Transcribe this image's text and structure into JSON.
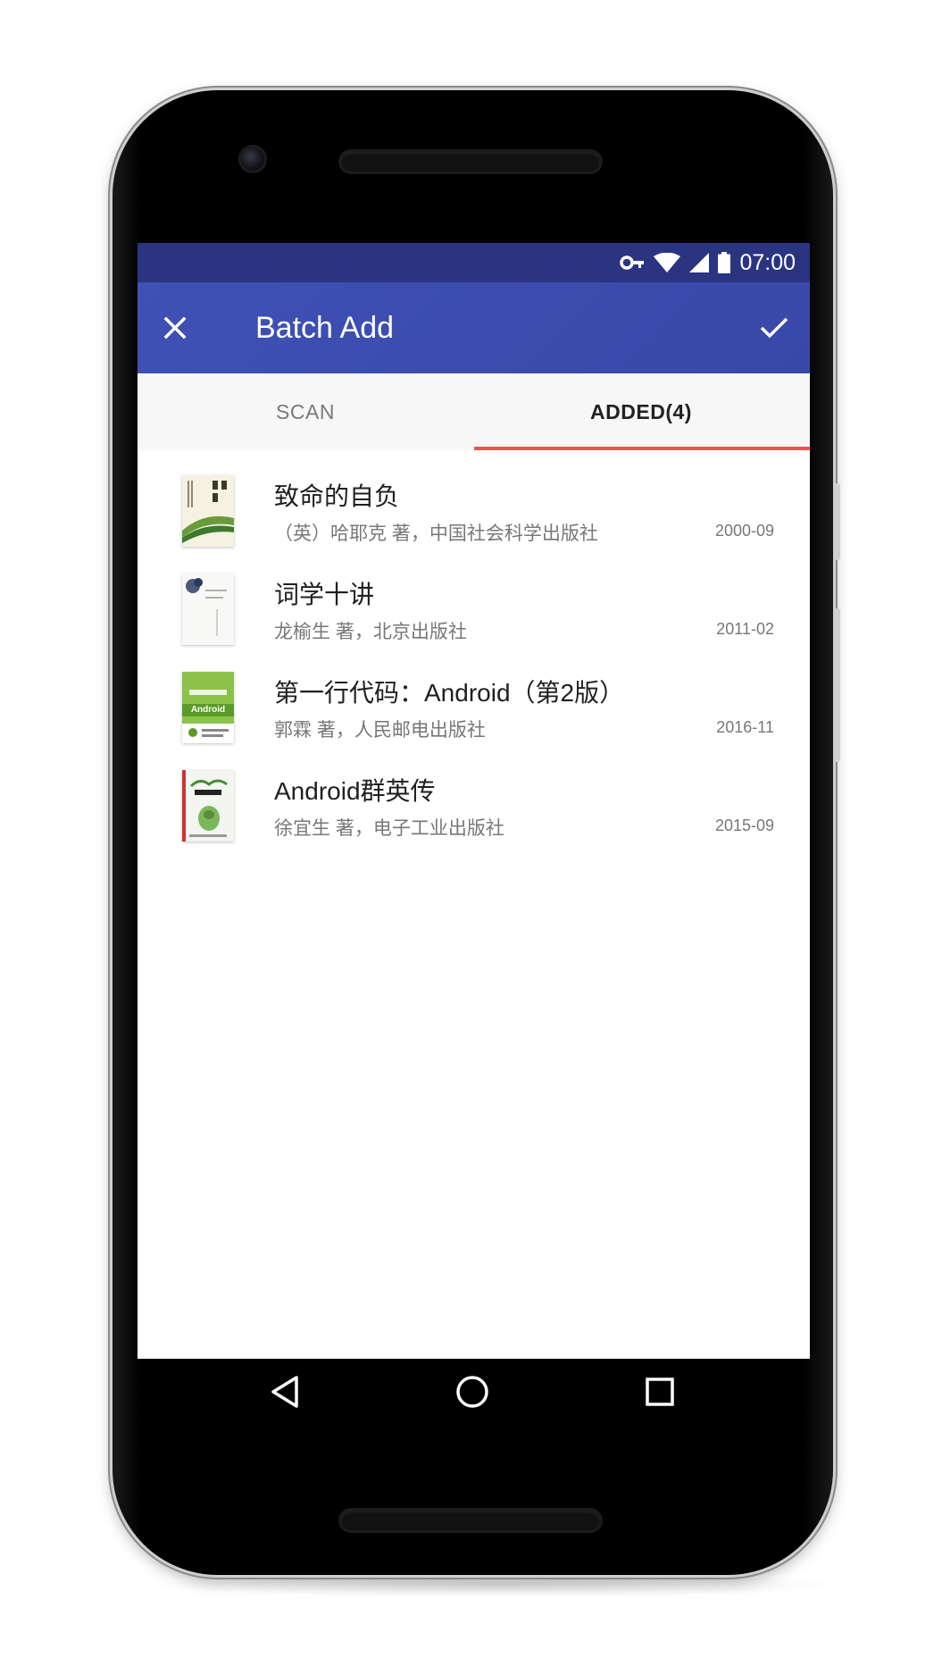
{
  "status_bar": {
    "time": "07:00",
    "icons": [
      "vpn-key-icon",
      "wifi-icon",
      "signal-icon",
      "battery-icon"
    ]
  },
  "toolbar": {
    "title": "Batch Add",
    "close_icon": "close-icon",
    "confirm_icon": "check-icon",
    "background_color": "#3f51b5",
    "status_color": "#2b3481"
  },
  "tabs": [
    {
      "label": "SCAN",
      "selected": false
    },
    {
      "label": "ADDED(4)",
      "selected": true
    }
  ],
  "tab_indicator_color": "#ef5350",
  "books": [
    {
      "title": "致命的自负",
      "meta": "（英）哈耶克 著，中国社会科学出版社",
      "date": "2000-09"
    },
    {
      "title": "词学十讲",
      "meta": "龙榆生 著，北京出版社",
      "date": "2011-02"
    },
    {
      "title": "第一行代码：Android（第2版）",
      "meta": "郭霖 著，人民邮电出版社",
      "date": "2016-11"
    },
    {
      "title": "Android群英传",
      "meta": "徐宜生 著，电子工业出版社",
      "date": "2015-09"
    }
  ],
  "cover_text": {
    "book3": "Android"
  },
  "nav": {
    "back_icon": "back-triangle-icon",
    "home_icon": "home-circle-icon",
    "recents_icon": "recents-square-icon"
  }
}
